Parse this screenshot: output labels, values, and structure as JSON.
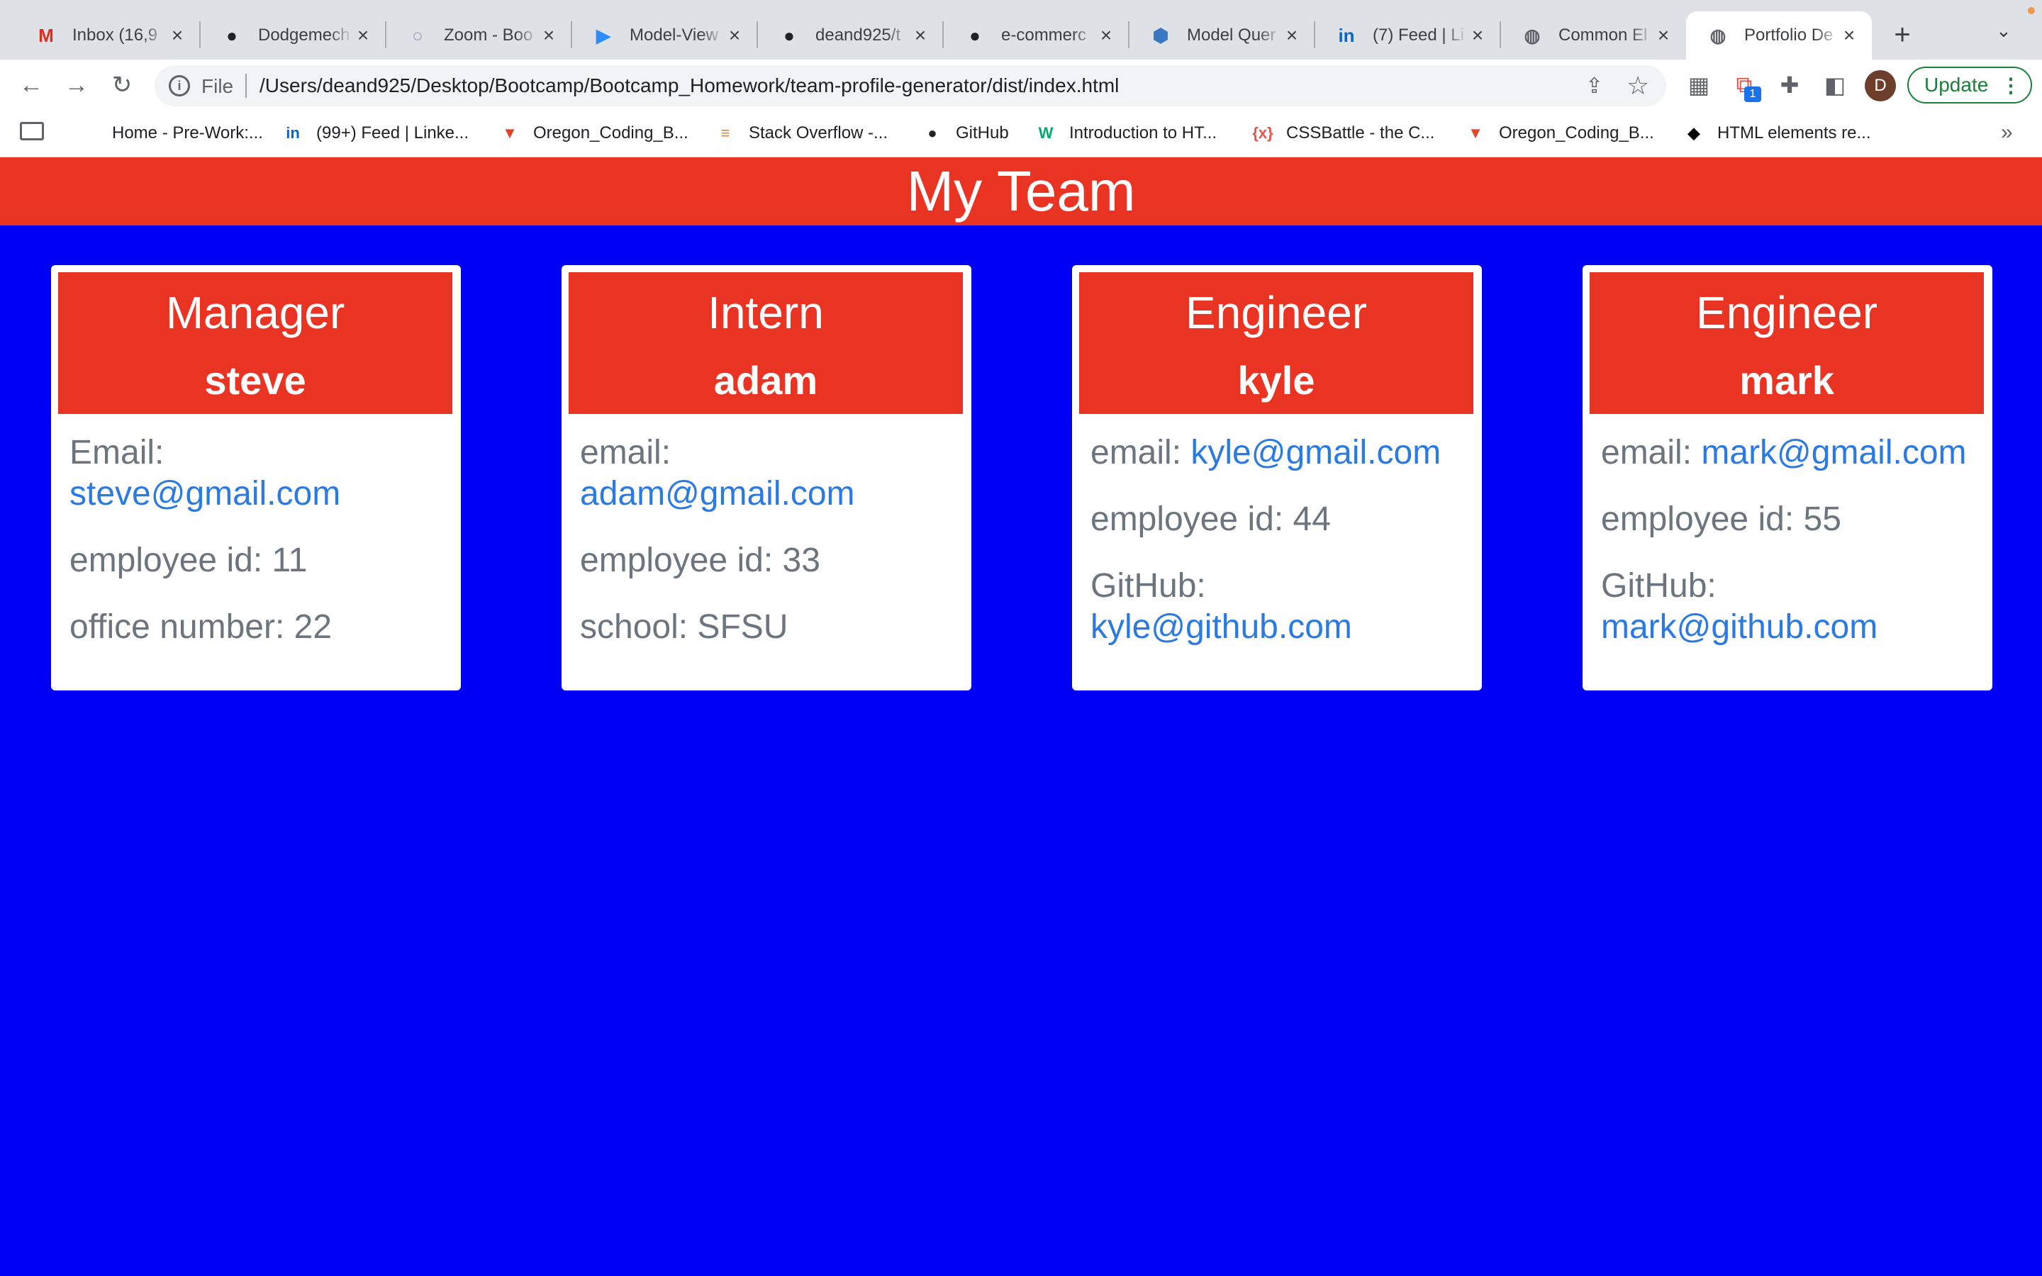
{
  "browser": {
    "tabs": [
      {
        "title": "Inbox (16,9",
        "icon": "gmail-icon",
        "glyph": "M",
        "color": "#d93025",
        "active": false
      },
      {
        "title": "Dodgemech",
        "icon": "github-icon",
        "glyph": "●",
        "color": "#202124",
        "active": false
      },
      {
        "title": "Zoom - Boo",
        "icon": "zoom-doc-icon",
        "glyph": "○",
        "color": "#ffffff",
        "active": false
      },
      {
        "title": "Model-View",
        "icon": "zoom-video-icon",
        "glyph": "▶",
        "color": "#2d8cff",
        "active": false
      },
      {
        "title": "deand925/t",
        "icon": "github-icon",
        "glyph": "●",
        "color": "#202124",
        "active": false
      },
      {
        "title": "e-commerc",
        "icon": "github-icon",
        "glyph": "●",
        "color": "#202124",
        "active": false
      },
      {
        "title": "Model Quer",
        "icon": "sequelize-icon",
        "glyph": "⬢",
        "color": "#3b76c3",
        "active": false
      },
      {
        "title": "(7) Feed | Li",
        "icon": "linkedin-icon",
        "glyph": "in",
        "color": "#0a66c2",
        "active": false
      },
      {
        "title": "Common El",
        "icon": "globe-icon",
        "glyph": "◍",
        "color": "#5f6368",
        "active": false
      },
      {
        "title": "Portfolio De",
        "icon": "globe-icon",
        "glyph": "◍",
        "color": "#5f6368",
        "active": true
      }
    ],
    "address": {
      "scheme_label": "File",
      "url": "/Users/deand925/Desktop/Bootcamp/Bootcamp_Homework/team-profile-generator/dist/index.html"
    },
    "profile_initial": "D",
    "extension_badge": "1",
    "update_label": "Update",
    "bookmarks": [
      {
        "label": "Home - Pre-Work:...",
        "icon": "blank-page-icon",
        "glyph": "",
        "color": "#ffffff"
      },
      {
        "label": "(99+) Feed | Linke...",
        "icon": "linkedin-icon",
        "glyph": "in",
        "color": "#0a66c2"
      },
      {
        "label": "Oregon_Coding_B...",
        "icon": "gitlab-icon",
        "glyph": "▼",
        "color": "#e24329"
      },
      {
        "label": "Stack Overflow -...",
        "icon": "stackoverflow-icon",
        "glyph": "≡",
        "color": "#f48024"
      },
      {
        "label": "GitHub",
        "icon": "github-icon",
        "glyph": "●",
        "color": "#202124"
      },
      {
        "label": "Introduction to HT...",
        "icon": "w3schools-icon",
        "glyph": "W",
        "color": "#04aa6d"
      },
      {
        "label": "CSSBattle - the C...",
        "icon": "cssbattle-icon",
        "glyph": "{x}",
        "color": "#e2574c"
      },
      {
        "label": "Oregon_Coding_B...",
        "icon": "gitlab-icon",
        "glyph": "▼",
        "color": "#e24329"
      },
      {
        "label": "HTML elements re...",
        "icon": "mdn-icon",
        "glyph": "◆",
        "color": "#000000"
      }
    ]
  },
  "page": {
    "title": "My Team",
    "colors": {
      "header": "#e93323",
      "background": "#0000f5",
      "link": "#2a7ae2",
      "text": "#6c757d"
    },
    "cards": [
      {
        "role": "Manager",
        "name": "steve",
        "email_label": "Email:",
        "email": "steve@gmail.com",
        "id_text": "employee id: 11",
        "extra_text": "office number: 22",
        "extra_link": ""
      },
      {
        "role": "Intern",
        "name": "adam",
        "email_label": "email:",
        "email": "adam@gmail.com",
        "id_text": "employee id: 33",
        "extra_text": "school: SFSU",
        "extra_link": ""
      },
      {
        "role": "Engineer",
        "name": "kyle",
        "email_label": "email:",
        "email": "kyle@gmail.com",
        "id_text": "employee id: 44",
        "extra_text": "GitHub:",
        "extra_link": "kyle@github.com"
      },
      {
        "role": "Engineer",
        "name": "mark",
        "email_label": "email:",
        "email": "mark@gmail.com",
        "id_text": "employee id: 55",
        "extra_text": "GitHub:",
        "extra_link": "mark@github.com"
      }
    ]
  }
}
